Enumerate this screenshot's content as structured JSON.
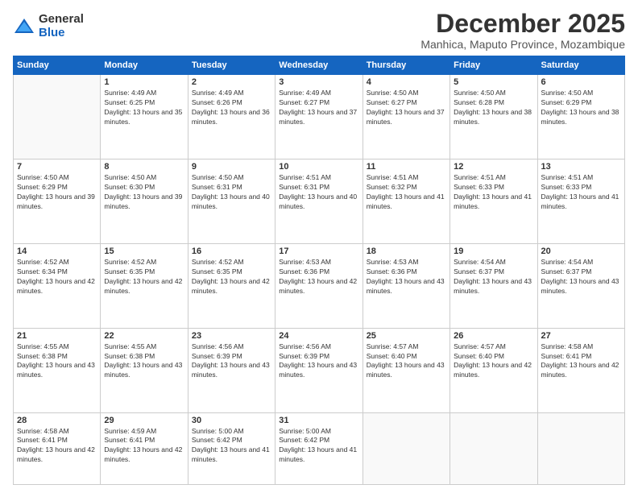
{
  "logo": {
    "general": "General",
    "blue": "Blue"
  },
  "header": {
    "month": "December 2025",
    "location": "Manhica, Maputo Province, Mozambique"
  },
  "days_of_week": [
    "Sunday",
    "Monday",
    "Tuesday",
    "Wednesday",
    "Thursday",
    "Friday",
    "Saturday"
  ],
  "weeks": [
    [
      {
        "day": "",
        "sunrise": "",
        "sunset": "",
        "daylight": ""
      },
      {
        "day": "1",
        "sunrise": "Sunrise: 4:49 AM",
        "sunset": "Sunset: 6:25 PM",
        "daylight": "Daylight: 13 hours and 35 minutes."
      },
      {
        "day": "2",
        "sunrise": "Sunrise: 4:49 AM",
        "sunset": "Sunset: 6:26 PM",
        "daylight": "Daylight: 13 hours and 36 minutes."
      },
      {
        "day": "3",
        "sunrise": "Sunrise: 4:49 AM",
        "sunset": "Sunset: 6:27 PM",
        "daylight": "Daylight: 13 hours and 37 minutes."
      },
      {
        "day": "4",
        "sunrise": "Sunrise: 4:50 AM",
        "sunset": "Sunset: 6:27 PM",
        "daylight": "Daylight: 13 hours and 37 minutes."
      },
      {
        "day": "5",
        "sunrise": "Sunrise: 4:50 AM",
        "sunset": "Sunset: 6:28 PM",
        "daylight": "Daylight: 13 hours and 38 minutes."
      },
      {
        "day": "6",
        "sunrise": "Sunrise: 4:50 AM",
        "sunset": "Sunset: 6:29 PM",
        "daylight": "Daylight: 13 hours and 38 minutes."
      }
    ],
    [
      {
        "day": "7",
        "sunrise": "Sunrise: 4:50 AM",
        "sunset": "Sunset: 6:29 PM",
        "daylight": "Daylight: 13 hours and 39 minutes."
      },
      {
        "day": "8",
        "sunrise": "Sunrise: 4:50 AM",
        "sunset": "Sunset: 6:30 PM",
        "daylight": "Daylight: 13 hours and 39 minutes."
      },
      {
        "day": "9",
        "sunrise": "Sunrise: 4:50 AM",
        "sunset": "Sunset: 6:31 PM",
        "daylight": "Daylight: 13 hours and 40 minutes."
      },
      {
        "day": "10",
        "sunrise": "Sunrise: 4:51 AM",
        "sunset": "Sunset: 6:31 PM",
        "daylight": "Daylight: 13 hours and 40 minutes."
      },
      {
        "day": "11",
        "sunrise": "Sunrise: 4:51 AM",
        "sunset": "Sunset: 6:32 PM",
        "daylight": "Daylight: 13 hours and 41 minutes."
      },
      {
        "day": "12",
        "sunrise": "Sunrise: 4:51 AM",
        "sunset": "Sunset: 6:33 PM",
        "daylight": "Daylight: 13 hours and 41 minutes."
      },
      {
        "day": "13",
        "sunrise": "Sunrise: 4:51 AM",
        "sunset": "Sunset: 6:33 PM",
        "daylight": "Daylight: 13 hours and 41 minutes."
      }
    ],
    [
      {
        "day": "14",
        "sunrise": "Sunrise: 4:52 AM",
        "sunset": "Sunset: 6:34 PM",
        "daylight": "Daylight: 13 hours and 42 minutes."
      },
      {
        "day": "15",
        "sunrise": "Sunrise: 4:52 AM",
        "sunset": "Sunset: 6:35 PM",
        "daylight": "Daylight: 13 hours and 42 minutes."
      },
      {
        "day": "16",
        "sunrise": "Sunrise: 4:52 AM",
        "sunset": "Sunset: 6:35 PM",
        "daylight": "Daylight: 13 hours and 42 minutes."
      },
      {
        "day": "17",
        "sunrise": "Sunrise: 4:53 AM",
        "sunset": "Sunset: 6:36 PM",
        "daylight": "Daylight: 13 hours and 42 minutes."
      },
      {
        "day": "18",
        "sunrise": "Sunrise: 4:53 AM",
        "sunset": "Sunset: 6:36 PM",
        "daylight": "Daylight: 13 hours and 43 minutes."
      },
      {
        "day": "19",
        "sunrise": "Sunrise: 4:54 AM",
        "sunset": "Sunset: 6:37 PM",
        "daylight": "Daylight: 13 hours and 43 minutes."
      },
      {
        "day": "20",
        "sunrise": "Sunrise: 4:54 AM",
        "sunset": "Sunset: 6:37 PM",
        "daylight": "Daylight: 13 hours and 43 minutes."
      }
    ],
    [
      {
        "day": "21",
        "sunrise": "Sunrise: 4:55 AM",
        "sunset": "Sunset: 6:38 PM",
        "daylight": "Daylight: 13 hours and 43 minutes."
      },
      {
        "day": "22",
        "sunrise": "Sunrise: 4:55 AM",
        "sunset": "Sunset: 6:38 PM",
        "daylight": "Daylight: 13 hours and 43 minutes."
      },
      {
        "day": "23",
        "sunrise": "Sunrise: 4:56 AM",
        "sunset": "Sunset: 6:39 PM",
        "daylight": "Daylight: 13 hours and 43 minutes."
      },
      {
        "day": "24",
        "sunrise": "Sunrise: 4:56 AM",
        "sunset": "Sunset: 6:39 PM",
        "daylight": "Daylight: 13 hours and 43 minutes."
      },
      {
        "day": "25",
        "sunrise": "Sunrise: 4:57 AM",
        "sunset": "Sunset: 6:40 PM",
        "daylight": "Daylight: 13 hours and 43 minutes."
      },
      {
        "day": "26",
        "sunrise": "Sunrise: 4:57 AM",
        "sunset": "Sunset: 6:40 PM",
        "daylight": "Daylight: 13 hours and 42 minutes."
      },
      {
        "day": "27",
        "sunrise": "Sunrise: 4:58 AM",
        "sunset": "Sunset: 6:41 PM",
        "daylight": "Daylight: 13 hours and 42 minutes."
      }
    ],
    [
      {
        "day": "28",
        "sunrise": "Sunrise: 4:58 AM",
        "sunset": "Sunset: 6:41 PM",
        "daylight": "Daylight: 13 hours and 42 minutes."
      },
      {
        "day": "29",
        "sunrise": "Sunrise: 4:59 AM",
        "sunset": "Sunset: 6:41 PM",
        "daylight": "Daylight: 13 hours and 42 minutes."
      },
      {
        "day": "30",
        "sunrise": "Sunrise: 5:00 AM",
        "sunset": "Sunset: 6:42 PM",
        "daylight": "Daylight: 13 hours and 41 minutes."
      },
      {
        "day": "31",
        "sunrise": "Sunrise: 5:00 AM",
        "sunset": "Sunset: 6:42 PM",
        "daylight": "Daylight: 13 hours and 41 minutes."
      },
      {
        "day": "",
        "sunrise": "",
        "sunset": "",
        "daylight": ""
      },
      {
        "day": "",
        "sunrise": "",
        "sunset": "",
        "daylight": ""
      },
      {
        "day": "",
        "sunrise": "",
        "sunset": "",
        "daylight": ""
      }
    ]
  ]
}
